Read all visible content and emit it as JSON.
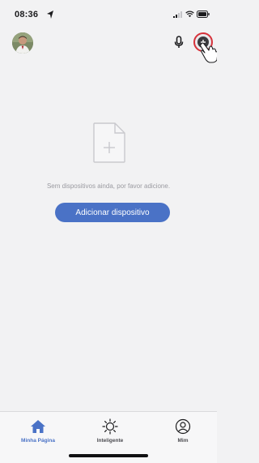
{
  "status_bar": {
    "time": "08:36",
    "icons": [
      "location-arrow-icon",
      "cellular-signal-icon",
      "wifi-icon",
      "battery-icon"
    ]
  },
  "header": {
    "avatar": "user-avatar",
    "icons": [
      "microphone-icon",
      "add-circle-icon"
    ]
  },
  "empty_state": {
    "icon": "document-add-icon",
    "message": "Sem dispositivos ainda, por favor adicione.",
    "button_label": "Adicionar dispositivo"
  },
  "tab_bar": {
    "tabs": [
      {
        "label": "Minha Página",
        "icon": "home-icon",
        "active": true
      },
      {
        "label": "Inteligente",
        "icon": "sun-icon",
        "active": false
      },
      {
        "label": "Mim",
        "icon": "person-icon",
        "active": false
      }
    ]
  },
  "colors": {
    "accent": "#4a72c6",
    "background": "#f2f2f3",
    "highlight_ring": "#d6323a"
  }
}
